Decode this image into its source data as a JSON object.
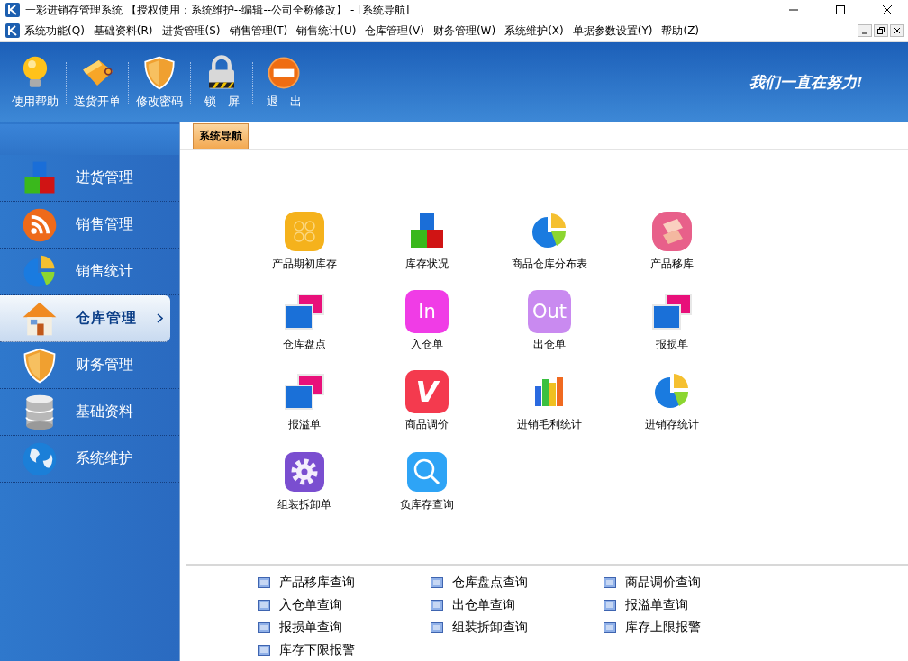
{
  "window": {
    "title": "一彩进销存管理系统 【授权使用：系统维护--编辑--公司全称修改】 - [系统导航]"
  },
  "menu": [
    "系统功能(Q)",
    "基础资料(R)",
    "进货管理(S)",
    "销售管理(T)",
    "销售统计(U)",
    "仓库管理(V)",
    "财务管理(W)",
    "系统维护(X)",
    "单据参数设置(Y)",
    "帮助(Z)"
  ],
  "toolbar": [
    {
      "label": "使用帮助",
      "kind": "bulb"
    },
    {
      "label": "送货开单",
      "kind": "tag"
    },
    {
      "label": "修改密码",
      "kind": "shield"
    },
    {
      "label": "锁　屏",
      "kind": "lock"
    },
    {
      "label": "退　出",
      "kind": "exit"
    }
  ],
  "slogan": "我们一直在努力!",
  "sidebar": {
    "items": [
      {
        "label": "进货管理",
        "kind": "blocks",
        "selected": false
      },
      {
        "label": "销售管理",
        "kind": "rss",
        "selected": false
      },
      {
        "label": "销售统计",
        "kind": "pie",
        "selected": false
      },
      {
        "label": "仓库管理",
        "kind": "house",
        "selected": true
      },
      {
        "label": "财务管理",
        "kind": "shield",
        "selected": false
      },
      {
        "label": "基础资料",
        "kind": "database",
        "selected": false
      },
      {
        "label": "系统维护",
        "kind": "globe",
        "selected": false
      }
    ]
  },
  "tab": {
    "label": "系统导航"
  },
  "functions": [
    {
      "label": "产品期初库存",
      "kind": "coins"
    },
    {
      "label": "库存状况",
      "kind": "blocks"
    },
    {
      "label": "商品仓库分布表",
      "kind": "pie"
    },
    {
      "label": "产品移库",
      "kind": "layers"
    },
    {
      "label": "仓库盘点",
      "kind": "windows"
    },
    {
      "label": "入仓单",
      "kind": "tile",
      "badge": "In",
      "color": "#f03ce6"
    },
    {
      "label": "出仓单",
      "kind": "tile",
      "badge": "Out",
      "color": "#c98af0"
    },
    {
      "label": "报损单",
      "kind": "windows"
    },
    {
      "label": "报溢单",
      "kind": "windows"
    },
    {
      "label": "商品调价",
      "kind": "tile",
      "badge": "V",
      "color": "#f43a4e"
    },
    {
      "label": "进销毛利统计",
      "kind": "bars"
    },
    {
      "label": "进销存统计",
      "kind": "pie"
    },
    {
      "label": "组装拆卸单",
      "kind": "gear"
    },
    {
      "label": "负库存查询",
      "kind": "search"
    }
  ],
  "queries": [
    "产品移库查询",
    "仓库盘点查询",
    "商品调价查询",
    "入仓单查询",
    "出仓单查询",
    "报溢单查询",
    "报损单查询",
    "组装拆卸查询",
    "库存上限报警",
    "库存下限报警"
  ]
}
